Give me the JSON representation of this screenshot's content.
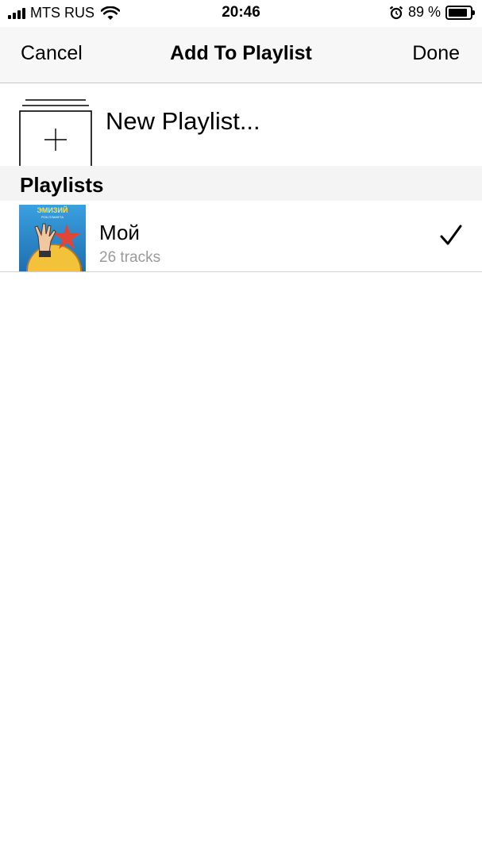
{
  "status_bar": {
    "carrier": "MTS RUS",
    "time": "20:46",
    "battery_percent": "89 %",
    "battery_level": 0.89,
    "icons": [
      "signal-icon",
      "wifi-icon",
      "alarm-icon",
      "battery-icon"
    ]
  },
  "nav": {
    "cancel_label": "Cancel",
    "title": "Add To Playlist",
    "done_label": "Done"
  },
  "new_playlist": {
    "label": "New Playlist...",
    "icon": "new-playlist-icon"
  },
  "section": {
    "title": "Playlists"
  },
  "playlists": [
    {
      "name": "Мой",
      "tracks": "26 tracks",
      "selected": true,
      "artwork_text": "ЭМИЗИЙ",
      "artwork_subtext": "РОК-ПЛАНЕТА"
    }
  ],
  "colors": {
    "nav_background": "#f7f7f7",
    "section_background": "#f4f4f4",
    "secondary_text": "#9a9a9a",
    "artwork_sky": "#2f8fd0",
    "artwork_star": "#e0453a",
    "artwork_planet": "#f2c33a"
  }
}
